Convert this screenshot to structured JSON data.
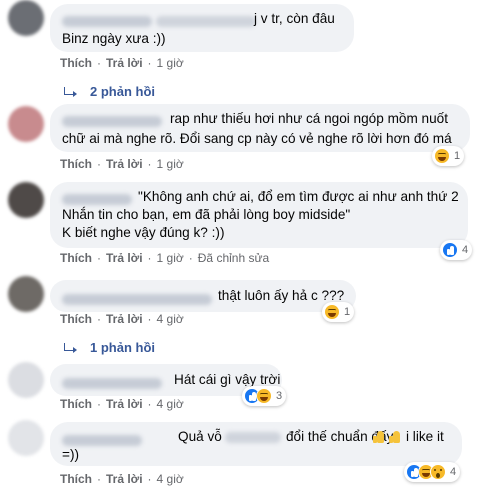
{
  "colors": {
    "bubble": "#f0f2f5",
    "meta": "#65676b",
    "link": "#385898",
    "like": "#1877f2",
    "haha": "#f7b928"
  },
  "comments": [
    {
      "text_line1": "j v tr, còn đâu",
      "text_line2": "Binz ngày xưa :))",
      "actions": {
        "like": "Thích",
        "reply": "Trả lời",
        "time": "1 giờ"
      },
      "replies_link": "2 phản hồi"
    },
    {
      "text_line1": "rap như thiếu hơi như cá ngoi ngóp mồm nuốt",
      "text_line2": "chữ ai mà nghe rõ. Đổi sang cp này có vẻ nghe rõ lời hơn đó má",
      "actions": {
        "like": "Thích",
        "reply": "Trả lời",
        "time": "1 giờ"
      },
      "reactions": {
        "icons": [
          "haha-icon"
        ],
        "count": "1"
      }
    },
    {
      "text_line1": "\"Không anh chứ ai, đổ em tìm được ai như anh thứ 2",
      "text_line2": "Nhắn tin cho bạn, em đã phải lòng boy midside\"",
      "text_line3": "K biết nghe vậy đúng k? :))",
      "actions": {
        "like": "Thích",
        "reply": "Trả lời",
        "time": "1 giờ",
        "edited": "Đã chỉnh sửa"
      },
      "reactions": {
        "icons": [
          "like-icon"
        ],
        "count": "4"
      }
    },
    {
      "text_line1": "thật luôn ấy hả c ???",
      "actions": {
        "like": "Thích",
        "reply": "Trả lời",
        "time": "4 giờ"
      },
      "reactions": {
        "icons": [
          "haha-icon"
        ],
        "count": "1"
      },
      "replies_link": "1 phản hồi"
    },
    {
      "text_line1": "Hát cái gì vậy trời",
      "actions": {
        "like": "Thích",
        "reply": "Trả lời",
        "time": "4 giờ"
      },
      "reactions": {
        "icons": [
          "like-icon",
          "haha-icon"
        ],
        "count": "3"
      }
    },
    {
      "text_line1a": "Quả vỗ",
      "text_line1b": "đổi thế chuẩn đấy",
      "text_line1c": "i like it",
      "text_line2": "=))",
      "actions": {
        "like": "Thích",
        "reply": "Trả lời",
        "time": "4 giờ"
      },
      "reactions": {
        "icons": [
          "like-icon",
          "haha-icon",
          "wow-icon"
        ],
        "count": "4"
      }
    }
  ]
}
